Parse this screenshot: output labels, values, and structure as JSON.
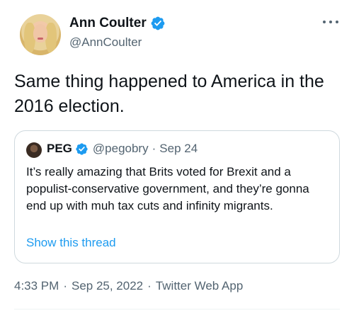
{
  "author": {
    "display_name": "Ann Coulter",
    "handle": "@AnnCoulter",
    "verified_icon": "verified-badge-icon",
    "more_icon": "more-horizontal-icon"
  },
  "tweet": {
    "text": "Same thing happened to America in the 2016 election."
  },
  "quoted_tweet": {
    "display_name": "PEG",
    "handle": "@pegobry",
    "separator": "·",
    "date": "Sep 24",
    "text": "It’s really amazing that Brits voted for Brexit and a populist-conservative government, and they’re gonna end up with muh tax cuts and infinity migrants.",
    "show_thread_label": "Show this thread"
  },
  "meta": {
    "time": "4:33 PM",
    "separator": "·",
    "date": "Sep 25, 2022",
    "app": "Twitter Web App"
  },
  "colors": {
    "accent": "#1d9bf0",
    "secondary_text": "#536471",
    "border": "#cfd9de"
  }
}
